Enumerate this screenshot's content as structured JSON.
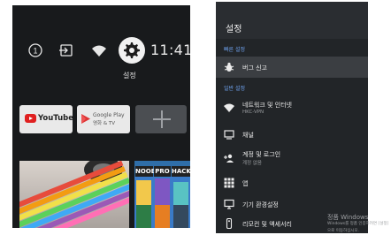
{
  "left_screen": {
    "status_bar": {
      "clock": "11:41",
      "settings_caption": "설정"
    },
    "apps": [
      {
        "name": "youtube",
        "label": "YouTube"
      },
      {
        "name": "google-play-movies",
        "label_top": "Google Play",
        "label_bottom": "영화 & TV"
      },
      {
        "name": "add-app",
        "label": ""
      }
    ],
    "thumbnails": {
      "game_labels": [
        "NOOB",
        "PRO",
        "HACKE"
      ]
    }
  },
  "right_screen": {
    "title": "설정",
    "sections": [
      {
        "label": "빠른 설정",
        "items": [
          {
            "label": "버그 신고",
            "sublabel": "",
            "icon": "bug-icon"
          }
        ]
      },
      {
        "label": "일반 설정",
        "items": [
          {
            "label": "네트워크 및 인터넷",
            "sublabel": "HKC-VPN",
            "icon": "wifi-icon"
          },
          {
            "label": "채널",
            "sublabel": "",
            "icon": "tv-icon"
          },
          {
            "label": "계정 및 로그인",
            "sublabel": "계정 없음",
            "icon": "add-account-icon"
          },
          {
            "label": "앱",
            "sublabel": "",
            "icon": "apps-grid-icon"
          },
          {
            "label": "기기 환경설정",
            "sublabel": "",
            "icon": "monitor-icon"
          },
          {
            "label": "리모컨 및 액세서리",
            "sublabel": "",
            "icon": "remote-icon"
          }
        ]
      }
    ]
  },
  "watermark": {
    "line1": "정품 Windows",
    "line2": "Windows를 정품 인증하려면 [설정]으로 이동하십시오."
  },
  "colors": {
    "left_bg": "#181a1c",
    "right_bg": "#222528",
    "accent_blue": "#6fa3f0",
    "youtube_red": "#e02020"
  }
}
